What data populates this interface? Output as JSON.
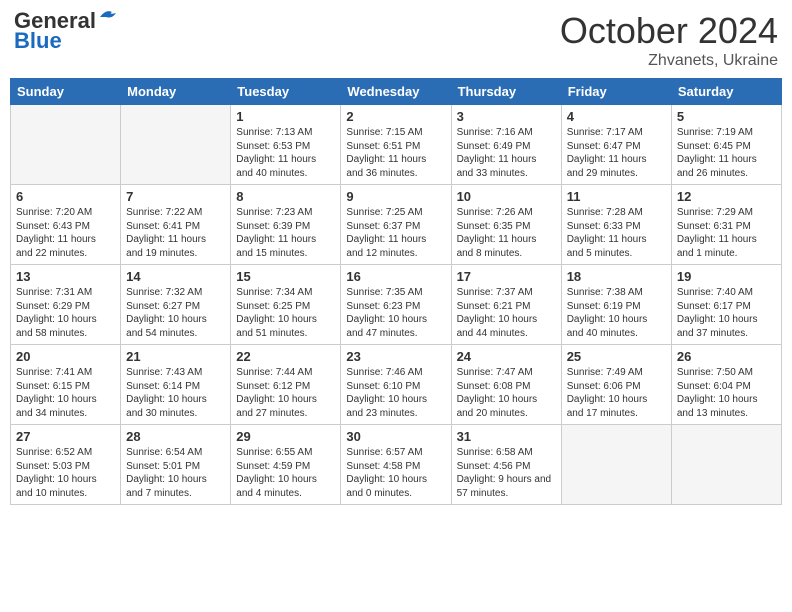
{
  "header": {
    "logo_line1": "General",
    "logo_line2": "Blue",
    "month": "October 2024",
    "location": "Zhvanets, Ukraine"
  },
  "weekdays": [
    "Sunday",
    "Monday",
    "Tuesday",
    "Wednesday",
    "Thursday",
    "Friday",
    "Saturday"
  ],
  "weeks": [
    [
      {
        "day": "",
        "empty": true
      },
      {
        "day": "",
        "empty": true
      },
      {
        "day": "1",
        "sunrise": "Sunrise: 7:13 AM",
        "sunset": "Sunset: 6:53 PM",
        "daylight": "Daylight: 11 hours and 40 minutes."
      },
      {
        "day": "2",
        "sunrise": "Sunrise: 7:15 AM",
        "sunset": "Sunset: 6:51 PM",
        "daylight": "Daylight: 11 hours and 36 minutes."
      },
      {
        "day": "3",
        "sunrise": "Sunrise: 7:16 AM",
        "sunset": "Sunset: 6:49 PM",
        "daylight": "Daylight: 11 hours and 33 minutes."
      },
      {
        "day": "4",
        "sunrise": "Sunrise: 7:17 AM",
        "sunset": "Sunset: 6:47 PM",
        "daylight": "Daylight: 11 hours and 29 minutes."
      },
      {
        "day": "5",
        "sunrise": "Sunrise: 7:19 AM",
        "sunset": "Sunset: 6:45 PM",
        "daylight": "Daylight: 11 hours and 26 minutes."
      }
    ],
    [
      {
        "day": "6",
        "sunrise": "Sunrise: 7:20 AM",
        "sunset": "Sunset: 6:43 PM",
        "daylight": "Daylight: 11 hours and 22 minutes."
      },
      {
        "day": "7",
        "sunrise": "Sunrise: 7:22 AM",
        "sunset": "Sunset: 6:41 PM",
        "daylight": "Daylight: 11 hours and 19 minutes."
      },
      {
        "day": "8",
        "sunrise": "Sunrise: 7:23 AM",
        "sunset": "Sunset: 6:39 PM",
        "daylight": "Daylight: 11 hours and 15 minutes."
      },
      {
        "day": "9",
        "sunrise": "Sunrise: 7:25 AM",
        "sunset": "Sunset: 6:37 PM",
        "daylight": "Daylight: 11 hours and 12 minutes."
      },
      {
        "day": "10",
        "sunrise": "Sunrise: 7:26 AM",
        "sunset": "Sunset: 6:35 PM",
        "daylight": "Daylight: 11 hours and 8 minutes."
      },
      {
        "day": "11",
        "sunrise": "Sunrise: 7:28 AM",
        "sunset": "Sunset: 6:33 PM",
        "daylight": "Daylight: 11 hours and 5 minutes."
      },
      {
        "day": "12",
        "sunrise": "Sunrise: 7:29 AM",
        "sunset": "Sunset: 6:31 PM",
        "daylight": "Daylight: 11 hours and 1 minute."
      }
    ],
    [
      {
        "day": "13",
        "sunrise": "Sunrise: 7:31 AM",
        "sunset": "Sunset: 6:29 PM",
        "daylight": "Daylight: 10 hours and 58 minutes."
      },
      {
        "day": "14",
        "sunrise": "Sunrise: 7:32 AM",
        "sunset": "Sunset: 6:27 PM",
        "daylight": "Daylight: 10 hours and 54 minutes."
      },
      {
        "day": "15",
        "sunrise": "Sunrise: 7:34 AM",
        "sunset": "Sunset: 6:25 PM",
        "daylight": "Daylight: 10 hours and 51 minutes."
      },
      {
        "day": "16",
        "sunrise": "Sunrise: 7:35 AM",
        "sunset": "Sunset: 6:23 PM",
        "daylight": "Daylight: 10 hours and 47 minutes."
      },
      {
        "day": "17",
        "sunrise": "Sunrise: 7:37 AM",
        "sunset": "Sunset: 6:21 PM",
        "daylight": "Daylight: 10 hours and 44 minutes."
      },
      {
        "day": "18",
        "sunrise": "Sunrise: 7:38 AM",
        "sunset": "Sunset: 6:19 PM",
        "daylight": "Daylight: 10 hours and 40 minutes."
      },
      {
        "day": "19",
        "sunrise": "Sunrise: 7:40 AM",
        "sunset": "Sunset: 6:17 PM",
        "daylight": "Daylight: 10 hours and 37 minutes."
      }
    ],
    [
      {
        "day": "20",
        "sunrise": "Sunrise: 7:41 AM",
        "sunset": "Sunset: 6:15 PM",
        "daylight": "Daylight: 10 hours and 34 minutes."
      },
      {
        "day": "21",
        "sunrise": "Sunrise: 7:43 AM",
        "sunset": "Sunset: 6:14 PM",
        "daylight": "Daylight: 10 hours and 30 minutes."
      },
      {
        "day": "22",
        "sunrise": "Sunrise: 7:44 AM",
        "sunset": "Sunset: 6:12 PM",
        "daylight": "Daylight: 10 hours and 27 minutes."
      },
      {
        "day": "23",
        "sunrise": "Sunrise: 7:46 AM",
        "sunset": "Sunset: 6:10 PM",
        "daylight": "Daylight: 10 hours and 23 minutes."
      },
      {
        "day": "24",
        "sunrise": "Sunrise: 7:47 AM",
        "sunset": "Sunset: 6:08 PM",
        "daylight": "Daylight: 10 hours and 20 minutes."
      },
      {
        "day": "25",
        "sunrise": "Sunrise: 7:49 AM",
        "sunset": "Sunset: 6:06 PM",
        "daylight": "Daylight: 10 hours and 17 minutes."
      },
      {
        "day": "26",
        "sunrise": "Sunrise: 7:50 AM",
        "sunset": "Sunset: 6:04 PM",
        "daylight": "Daylight: 10 hours and 13 minutes."
      }
    ],
    [
      {
        "day": "27",
        "sunrise": "Sunrise: 6:52 AM",
        "sunset": "Sunset: 5:03 PM",
        "daylight": "Daylight: 10 hours and 10 minutes."
      },
      {
        "day": "28",
        "sunrise": "Sunrise: 6:54 AM",
        "sunset": "Sunset: 5:01 PM",
        "daylight": "Daylight: 10 hours and 7 minutes."
      },
      {
        "day": "29",
        "sunrise": "Sunrise: 6:55 AM",
        "sunset": "Sunset: 4:59 PM",
        "daylight": "Daylight: 10 hours and 4 minutes."
      },
      {
        "day": "30",
        "sunrise": "Sunrise: 6:57 AM",
        "sunset": "Sunset: 4:58 PM",
        "daylight": "Daylight: 10 hours and 0 minutes."
      },
      {
        "day": "31",
        "sunrise": "Sunrise: 6:58 AM",
        "sunset": "Sunset: 4:56 PM",
        "daylight": "Daylight: 9 hours and 57 minutes."
      },
      {
        "day": "",
        "empty": true
      },
      {
        "day": "",
        "empty": true
      }
    ]
  ]
}
